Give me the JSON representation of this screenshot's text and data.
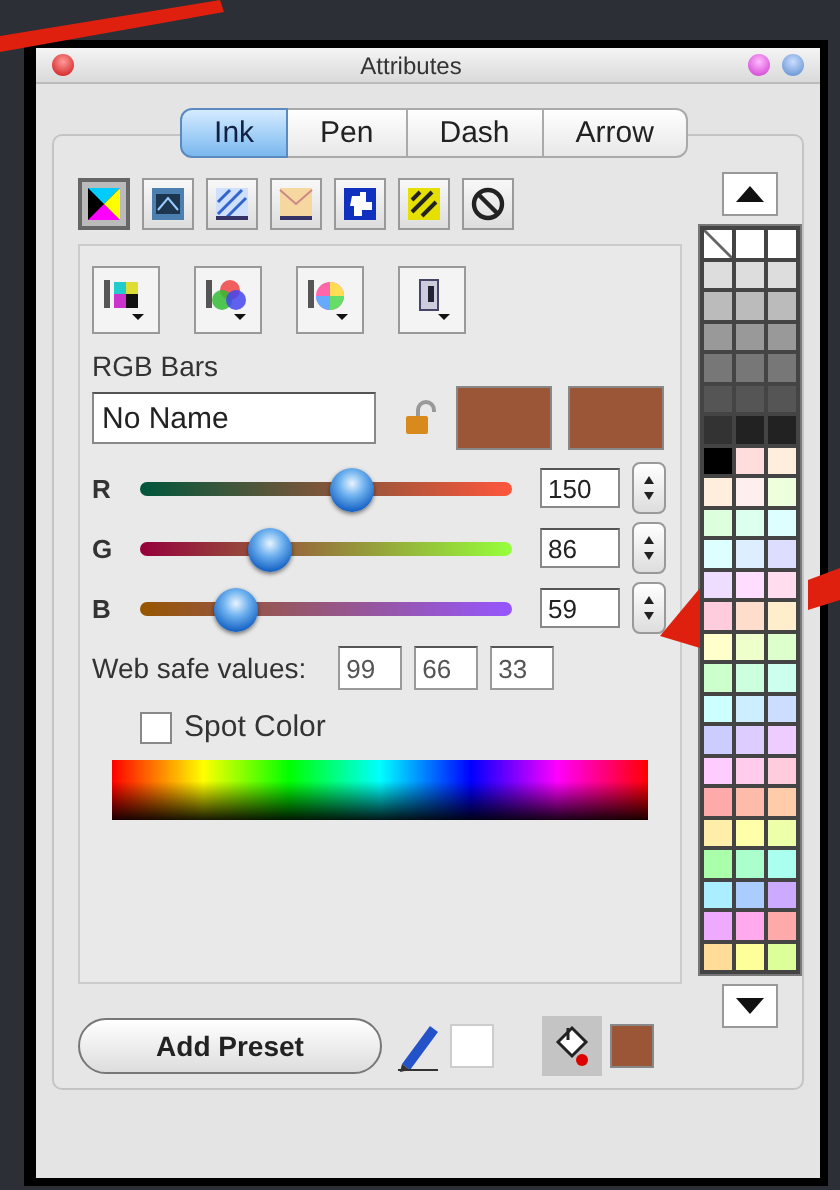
{
  "window": {
    "title": "Attributes"
  },
  "tabs": [
    {
      "label": "Ink",
      "selected": true
    },
    {
      "label": "Pen",
      "selected": false
    },
    {
      "label": "Dash",
      "selected": false
    },
    {
      "label": "Arrow",
      "selected": false
    }
  ],
  "fill_types": [
    {
      "kind": "cmyk",
      "selected": true
    },
    {
      "kind": "gradient",
      "selected": false
    },
    {
      "kind": "hatch",
      "selected": false
    },
    {
      "kind": "texture",
      "selected": false
    },
    {
      "kind": "pattern",
      "selected": false
    },
    {
      "kind": "tile",
      "selected": false
    },
    {
      "kind": "none",
      "selected": false
    }
  ],
  "color_models": [
    {
      "kind": "cmyk"
    },
    {
      "kind": "rgb"
    },
    {
      "kind": "wheel"
    },
    {
      "kind": "gray"
    }
  ],
  "mode_label": "RGB Bars",
  "name_field": {
    "value": "No Name"
  },
  "swatches": [
    {
      "color": "#9b5537"
    },
    {
      "color": "#9b5537"
    }
  ],
  "channels": [
    {
      "label": "R",
      "value": "150",
      "level": 0.57
    },
    {
      "label": "G",
      "value": "86",
      "level": 0.35
    },
    {
      "label": "B",
      "value": "59",
      "level": 0.26
    }
  ],
  "web_safe": {
    "label": "Web safe values:",
    "values": [
      "99",
      "66",
      "33"
    ]
  },
  "spot_color": {
    "label": "Spot Color",
    "checked": false
  },
  "palette": {
    "rows": [
      [
        {
          "kind": "none"
        },
        {
          "kind": "color",
          "color": "#ffffff"
        },
        {
          "kind": "color",
          "color": "#ffffff"
        }
      ],
      [
        {
          "kind": "color",
          "color": "#dddddd"
        },
        {
          "kind": "color",
          "color": "#dddddd"
        },
        {
          "kind": "color",
          "color": "#dddddd"
        }
      ],
      [
        {
          "kind": "color",
          "color": "#bbbbbb"
        },
        {
          "kind": "color",
          "color": "#bbbbbb"
        },
        {
          "kind": "color",
          "color": "#bbbbbb"
        }
      ],
      [
        {
          "kind": "color",
          "color": "#999999"
        },
        {
          "kind": "color",
          "color": "#999999"
        },
        {
          "kind": "color",
          "color": "#999999"
        }
      ],
      [
        {
          "kind": "color",
          "color": "#777777"
        },
        {
          "kind": "color",
          "color": "#777777"
        },
        {
          "kind": "color",
          "color": "#777777"
        }
      ],
      [
        {
          "kind": "color",
          "color": "#555555"
        },
        {
          "kind": "color",
          "color": "#555555"
        },
        {
          "kind": "color",
          "color": "#555555"
        }
      ],
      [
        {
          "kind": "color",
          "color": "#333333"
        },
        {
          "kind": "color",
          "color": "#222222"
        },
        {
          "kind": "color",
          "color": "#222222"
        }
      ],
      [
        {
          "kind": "color",
          "color": "#000000"
        },
        {
          "kind": "color",
          "color": "#ffdddd"
        },
        {
          "kind": "color",
          "color": "#ffeedd"
        }
      ],
      [
        {
          "kind": "color",
          "color": "#ffeedd"
        },
        {
          "kind": "color",
          "color": "#ffeeee"
        },
        {
          "kind": "color",
          "color": "#eeffdd"
        }
      ],
      [
        {
          "kind": "color",
          "color": "#ddffdd"
        },
        {
          "kind": "color",
          "color": "#ddffee"
        },
        {
          "kind": "color",
          "color": "#ddffff"
        }
      ],
      [
        {
          "kind": "color",
          "color": "#ddffff"
        },
        {
          "kind": "color",
          "color": "#ddeeff"
        },
        {
          "kind": "color",
          "color": "#ddddff"
        }
      ],
      [
        {
          "kind": "color",
          "color": "#eeddff"
        },
        {
          "kind": "color",
          "color": "#ffddff"
        },
        {
          "kind": "color",
          "color": "#ffddee"
        }
      ],
      [
        {
          "kind": "color",
          "color": "#ffccdd"
        },
        {
          "kind": "color",
          "color": "#ffddcc"
        },
        {
          "kind": "color",
          "color": "#ffeecc"
        }
      ],
      [
        {
          "kind": "color",
          "color": "#ffffcc"
        },
        {
          "kind": "color",
          "color": "#eeffcc"
        },
        {
          "kind": "color",
          "color": "#ddffcc"
        }
      ],
      [
        {
          "kind": "color",
          "color": "#ccffcc"
        },
        {
          "kind": "color",
          "color": "#ccffdd"
        },
        {
          "kind": "color",
          "color": "#ccffee"
        }
      ],
      [
        {
          "kind": "color",
          "color": "#ccffff"
        },
        {
          "kind": "color",
          "color": "#cceeff"
        },
        {
          "kind": "color",
          "color": "#ccddff"
        }
      ],
      [
        {
          "kind": "color",
          "color": "#ccccff"
        },
        {
          "kind": "color",
          "color": "#ddccff"
        },
        {
          "kind": "color",
          "color": "#eeccff"
        }
      ],
      [
        {
          "kind": "color",
          "color": "#ffccff"
        },
        {
          "kind": "color",
          "color": "#ffccee"
        },
        {
          "kind": "color",
          "color": "#ffccdd"
        }
      ],
      [
        {
          "kind": "color",
          "color": "#ffaaaa"
        },
        {
          "kind": "color",
          "color": "#ffbbaa"
        },
        {
          "kind": "color",
          "color": "#ffccaa"
        }
      ],
      [
        {
          "kind": "color",
          "color": "#ffeeaa"
        },
        {
          "kind": "color",
          "color": "#ffffaa"
        },
        {
          "kind": "color",
          "color": "#eeffaa"
        }
      ],
      [
        {
          "kind": "color",
          "color": "#aaffaa"
        },
        {
          "kind": "color",
          "color": "#aaffcc"
        },
        {
          "kind": "color",
          "color": "#aaffee"
        }
      ],
      [
        {
          "kind": "color",
          "color": "#aaeeff"
        },
        {
          "kind": "color",
          "color": "#aaccff"
        },
        {
          "kind": "color",
          "color": "#ccaaff"
        }
      ],
      [
        {
          "kind": "color",
          "color": "#eeaaff"
        },
        {
          "kind": "color",
          "color": "#ffaaee"
        },
        {
          "kind": "color",
          "color": "#ffaaaa"
        }
      ],
      [
        {
          "kind": "color",
          "color": "#ffdd99"
        },
        {
          "kind": "color",
          "color": "#ffff99"
        },
        {
          "kind": "color",
          "color": "#ddff99"
        }
      ]
    ]
  },
  "add_preset": "Add Preset",
  "style_swatches": [
    {
      "kind": "stroke",
      "color": "#ffffff"
    },
    {
      "kind": "fill",
      "color": "#9b5537"
    }
  ],
  "annotations": [
    {
      "kind": "line"
    },
    {
      "kind": "arrow"
    }
  ]
}
